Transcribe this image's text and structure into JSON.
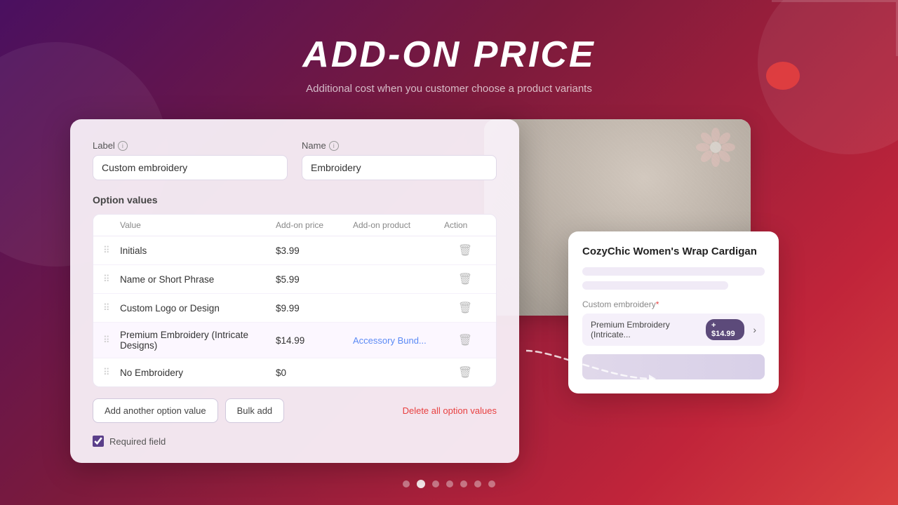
{
  "header": {
    "title": "ADD-ON PRICE",
    "subtitle": "Additional cost when you customer choose a product variants"
  },
  "form": {
    "label_field": {
      "label": "Label",
      "value": "Custom embroidery"
    },
    "name_field": {
      "label": "Name",
      "value": "Embroidery"
    },
    "option_values_title": "Option values",
    "table": {
      "columns": [
        "Value",
        "Add-on price",
        "Add-on product",
        "Action"
      ],
      "rows": [
        {
          "value": "Initials",
          "price": "$3.99",
          "product": "",
          "highlighted": false
        },
        {
          "value": "Name or Short Phrase",
          "price": "$5.99",
          "product": "",
          "highlighted": false
        },
        {
          "value": "Custom Logo or Design",
          "price": "$9.99",
          "product": "",
          "highlighted": false
        },
        {
          "value": "Premium Embroidery (Intricate Designs)",
          "price": "$14.99",
          "product": "Accessory Bund...",
          "highlighted": true
        },
        {
          "value": "No Embroidery",
          "price": "$0",
          "product": "",
          "highlighted": false
        }
      ]
    },
    "add_option_btn": "Add another option value",
    "bulk_add_btn": "Bulk add",
    "delete_all_btn": "Delete all option values",
    "required_field_label": "Required field"
  },
  "product_card": {
    "title": "CozyChic Women's Wrap Cardigan",
    "option_label": "Custom embroidery",
    "selected_option": "Premium Embroidery (Intricate...",
    "price_badge": "+ $14.99"
  },
  "pagination": {
    "total_dots": 7,
    "active_index": 1
  }
}
